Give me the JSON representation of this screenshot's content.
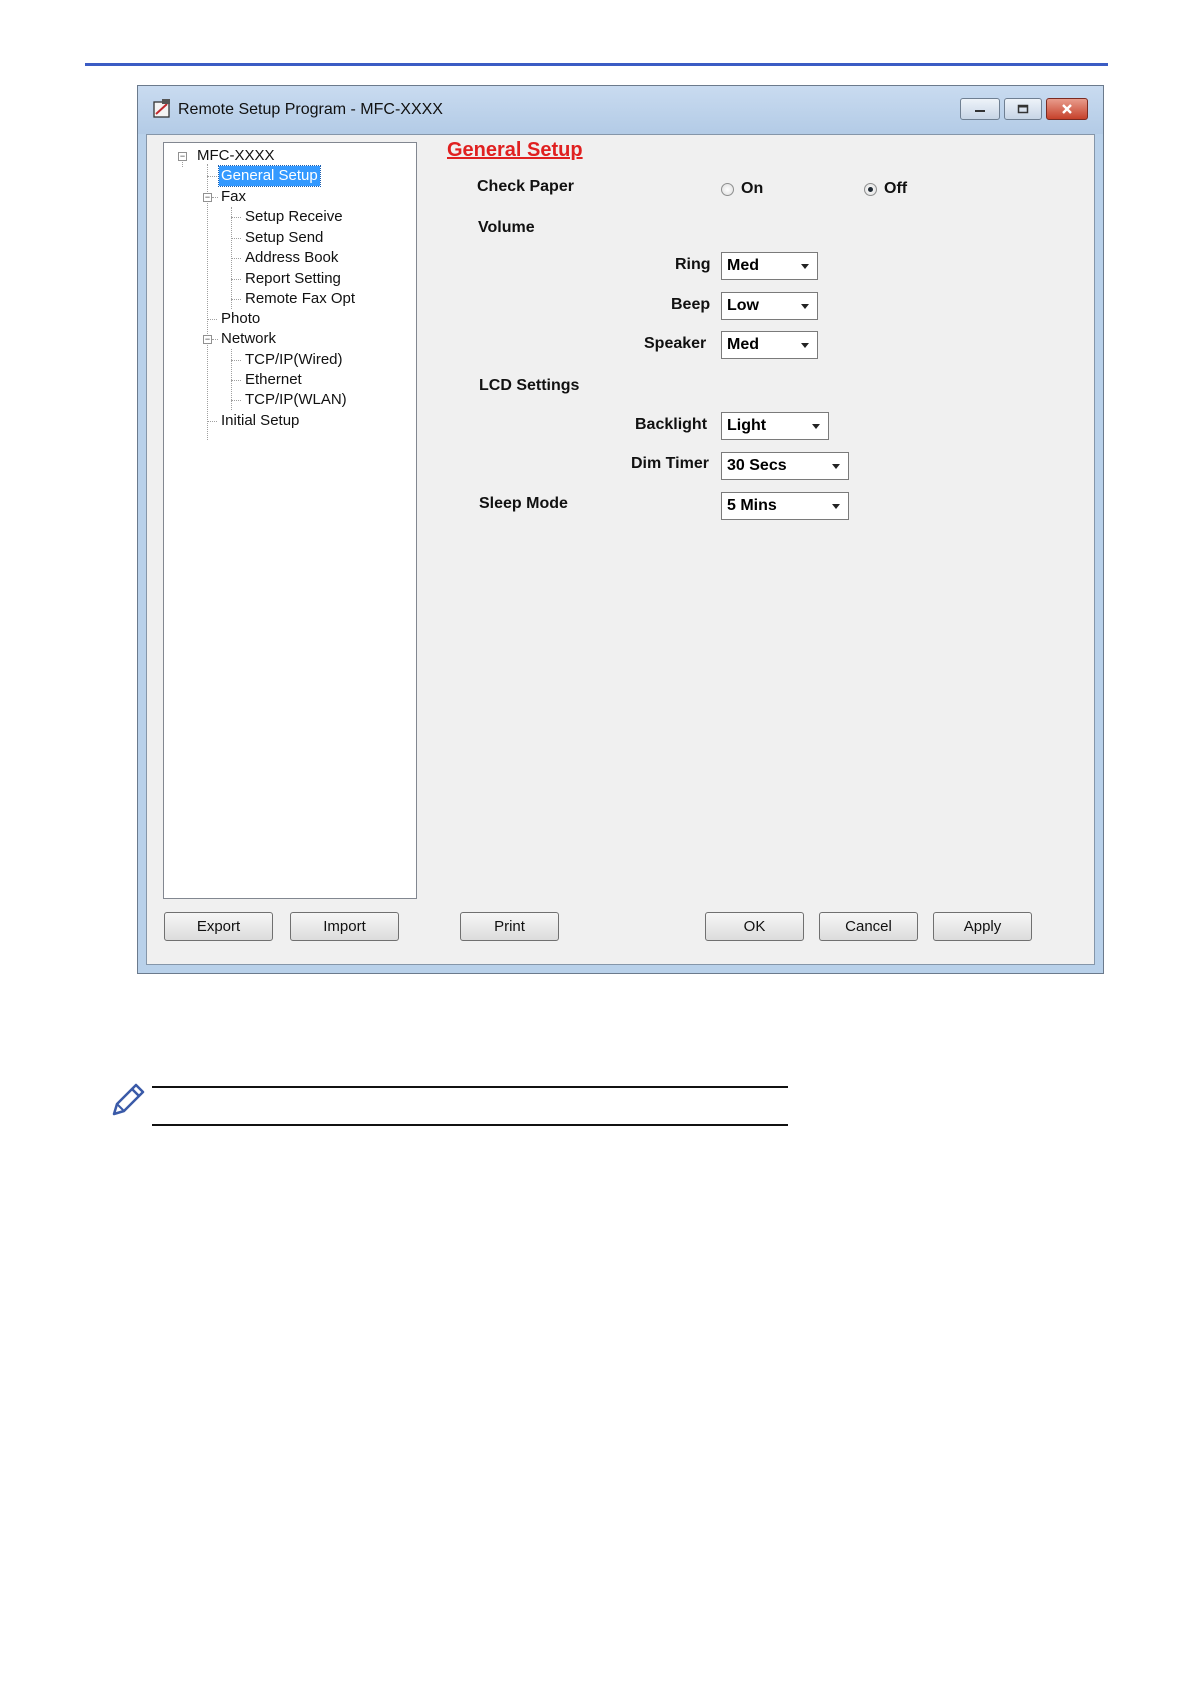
{
  "window": {
    "title": "Remote Setup Program - MFC-XXXX"
  },
  "tree": {
    "root": "MFC-XXXX",
    "general_setup": "General Setup",
    "fax": "Fax",
    "setup_receive": "Setup Receive",
    "setup_send": "Setup Send",
    "address_book": "Address Book",
    "report_setting": "Report Setting",
    "remote_fax_opt": "Remote Fax Opt",
    "photo": "Photo",
    "network": "Network",
    "tcpip_wired": "TCP/IP(Wired)",
    "ethernet": "Ethernet",
    "tcpip_wlan": "TCP/IP(WLAN)",
    "initial_setup": "Initial Setup",
    "selected": "General Setup"
  },
  "panel": {
    "title": "General Setup",
    "check_paper": {
      "label": "Check Paper",
      "on_label": "On",
      "off_label": "Off",
      "selected": "Off"
    },
    "volume": {
      "label": "Volume",
      "ring_label": "Ring",
      "ring_value": "Med",
      "beep_label": "Beep",
      "beep_value": "Low",
      "speaker_label": "Speaker",
      "speaker_value": "Med"
    },
    "lcd": {
      "label": "LCD Settings",
      "backlight_label": "Backlight",
      "backlight_value": "Light",
      "dim_timer_label": "Dim Timer",
      "dim_timer_value": "30 Secs"
    },
    "sleep": {
      "label": "Sleep Mode",
      "value": "5 Mins"
    }
  },
  "buttons": {
    "export": "Export",
    "import": "Import",
    "print": "Print",
    "ok": "OK",
    "cancel": "Cancel",
    "apply": "Apply"
  },
  "icons": {
    "note": "pencil-note-icon",
    "app": "remote-setup-app-icon"
  },
  "colors": {
    "section_title": "#e02020",
    "selection": "#3399ff",
    "top_rule": "#3b5cc4"
  }
}
